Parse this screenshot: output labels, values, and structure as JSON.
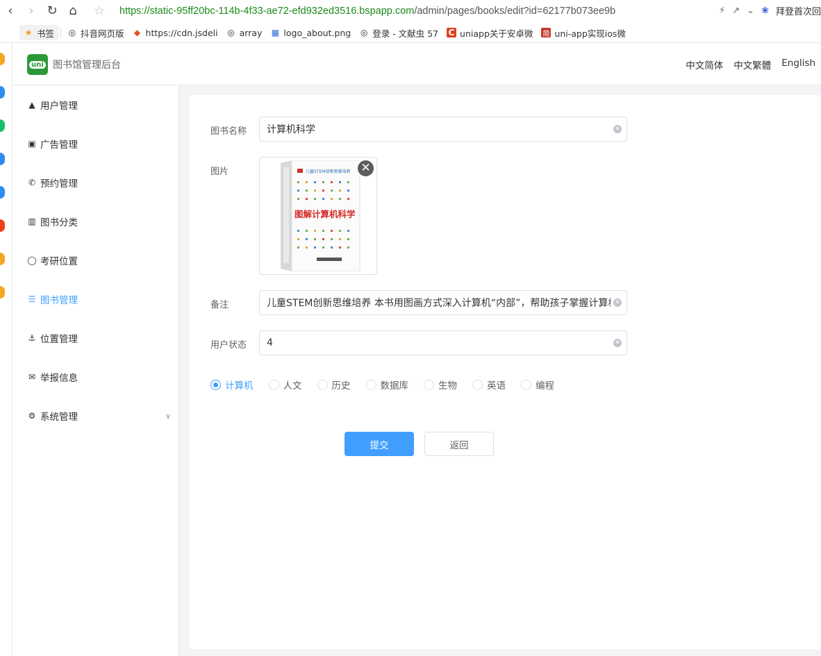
{
  "browser": {
    "url_proto": "https://",
    "url_host": "static-95ff20bc-114b-4f33-ae72-efd932ed3516.bspapp.com",
    "url_path": "/admin/pages/books/edit?id=62177b073ee9b",
    "right_text": "拜登首次回"
  },
  "bookmarks": [
    {
      "label": "书签",
      "icon": "star-icon"
    },
    {
      "label": "抖音网页版",
      "icon": "globe-icon"
    },
    {
      "label": "https://cdn.jsdeli",
      "icon": "shield-icon"
    },
    {
      "label": "array",
      "icon": "globe-icon"
    },
    {
      "label": "logo_about.png",
      "icon": "grid-icon"
    },
    {
      "label": "登录 - 文献虫 57",
      "icon": "globe-icon"
    },
    {
      "label": "uniapp关于安卓微",
      "icon": "c-logo-icon"
    },
    {
      "label": "uni-app实现ios微",
      "icon": "jian-logo-icon"
    }
  ],
  "header": {
    "logo_text": "uni",
    "title": "图书馆管理后台",
    "langs": [
      "中文简体",
      "中文繁體",
      "English"
    ]
  },
  "sidebar": {
    "items": [
      {
        "label": "用户管理",
        "icon": "person-icon"
      },
      {
        "label": "广告管理",
        "icon": "picture-icon"
      },
      {
        "label": "预约管理",
        "icon": "phone-icon"
      },
      {
        "label": "图书分类",
        "icon": "map-icon"
      },
      {
        "label": "考研位置",
        "icon": "chat-icon"
      },
      {
        "label": "图书管理",
        "icon": "list-icon"
      },
      {
        "label": "位置管理",
        "icon": "location-icon"
      },
      {
        "label": "举报信息",
        "icon": "mail-icon"
      },
      {
        "label": "系统管理",
        "icon": "gear-icon"
      }
    ],
    "active_index": 5
  },
  "form": {
    "name_label": "图书名称",
    "name_value": "计算机科学",
    "image_label": "图片",
    "book_cover_title": "图解计算机科学",
    "book_cover_series": "儿童STEM创新思维培养",
    "note_label": "备注",
    "note_value": "儿童STEM创新思维培养 本书用图画方式深入计算机“内部”，帮助孩子掌握计算机科学",
    "status_label": "用户状态",
    "status_value": "4",
    "categories": [
      "计算机",
      "人文",
      "历史",
      "数据库",
      "生物",
      "英语",
      "编程"
    ],
    "selected_category": "计算机",
    "submit_label": "提交",
    "back_label": "返回"
  },
  "colors": {
    "accent": "#409eff",
    "logo_green": "#2b9939",
    "url_green": "#1a8a1a"
  }
}
